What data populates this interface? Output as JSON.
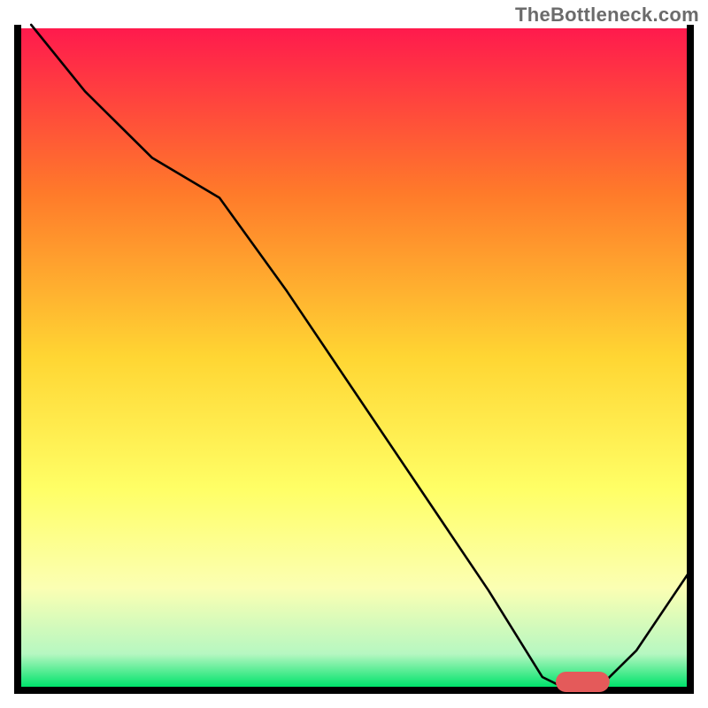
{
  "watermark": "TheBottleneck.com",
  "chart_data": {
    "type": "line",
    "title": "",
    "xlabel": "",
    "ylabel": "",
    "xlim": [
      0,
      100
    ],
    "ylim": [
      0,
      100
    ],
    "grid": false,
    "legend": false,
    "axes_visible": false,
    "background": {
      "type": "vertical-gradient",
      "stops": [
        {
          "pos": 0.0,
          "color": "#ff1a4d"
        },
        {
          "pos": 0.25,
          "color": "#ff7a2a"
        },
        {
          "pos": 0.5,
          "color": "#ffd633"
        },
        {
          "pos": 0.7,
          "color": "#ffff66"
        },
        {
          "pos": 0.85,
          "color": "#fbffb3"
        },
        {
          "pos": 0.95,
          "color": "#b6f7c1"
        },
        {
          "pos": 1.0,
          "color": "#00e36b"
        }
      ]
    },
    "series": [
      {
        "name": "bottleneck-curve",
        "color": "#000000",
        "width": 2,
        "x": [
          2,
          10,
          20,
          30,
          40,
          50,
          60,
          70,
          78,
          82,
          86,
          92,
          100
        ],
        "y": [
          100,
          90,
          80,
          74,
          60,
          45,
          30,
          15,
          2,
          0,
          0,
          6,
          18
        ]
      }
    ],
    "markers": [
      {
        "name": "optimal-zone",
        "shape": "rounded-rect",
        "color": "#e45a5a",
        "x_start": 80,
        "x_end": 88,
        "y": 0,
        "height": 2
      }
    ]
  }
}
